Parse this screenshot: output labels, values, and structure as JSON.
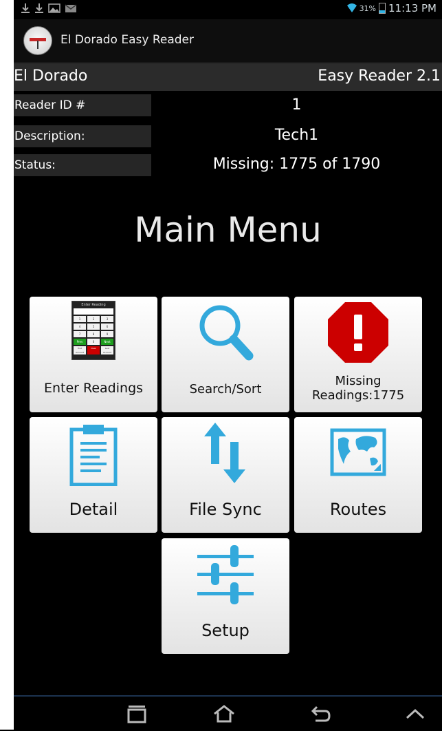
{
  "status_bar": {
    "battery_percent": "31%",
    "battery_level": 0.31,
    "time": "11:13 PM",
    "notification_icons": [
      "download-icon",
      "download-icon",
      "image-icon",
      "mail-icon"
    ]
  },
  "action_bar": {
    "app_title": "El Dorado Easy Reader"
  },
  "header": {
    "left": "El Dorado",
    "right": "Easy Reader 2.1"
  },
  "info": {
    "reader_id_label": "Reader ID #",
    "reader_id_value": "1",
    "description_label": "Description:",
    "description_value": "Tech1",
    "status_label": "Status:",
    "status_value": "Missing: 1775 of 1790"
  },
  "main_title": "Main Menu",
  "tiles": {
    "enter_readings": {
      "label": "Enter Readings",
      "mini_title": "Enter Reading",
      "keys": [
        "1",
        "2",
        "3",
        "4",
        "5",
        "6",
        "7",
        "8",
        "9",
        "Prev",
        "0",
        "Next"
      ],
      "bottom_keys": [
        "First Account",
        "Clear",
        "Last Account"
      ]
    },
    "search_sort": {
      "label": "Search/Sort"
    },
    "missing": {
      "label_line1": "Missing",
      "label_line2": "Readings:1775"
    },
    "detail": {
      "label": "Detail"
    },
    "file_sync": {
      "label": "File Sync"
    },
    "routes": {
      "label": "Routes"
    },
    "setup": {
      "label": "Setup"
    }
  },
  "colors": {
    "accent_blue": "#33b5e5",
    "stop_red": "#cc0000",
    "tile_bg": "#f2f2f2"
  }
}
